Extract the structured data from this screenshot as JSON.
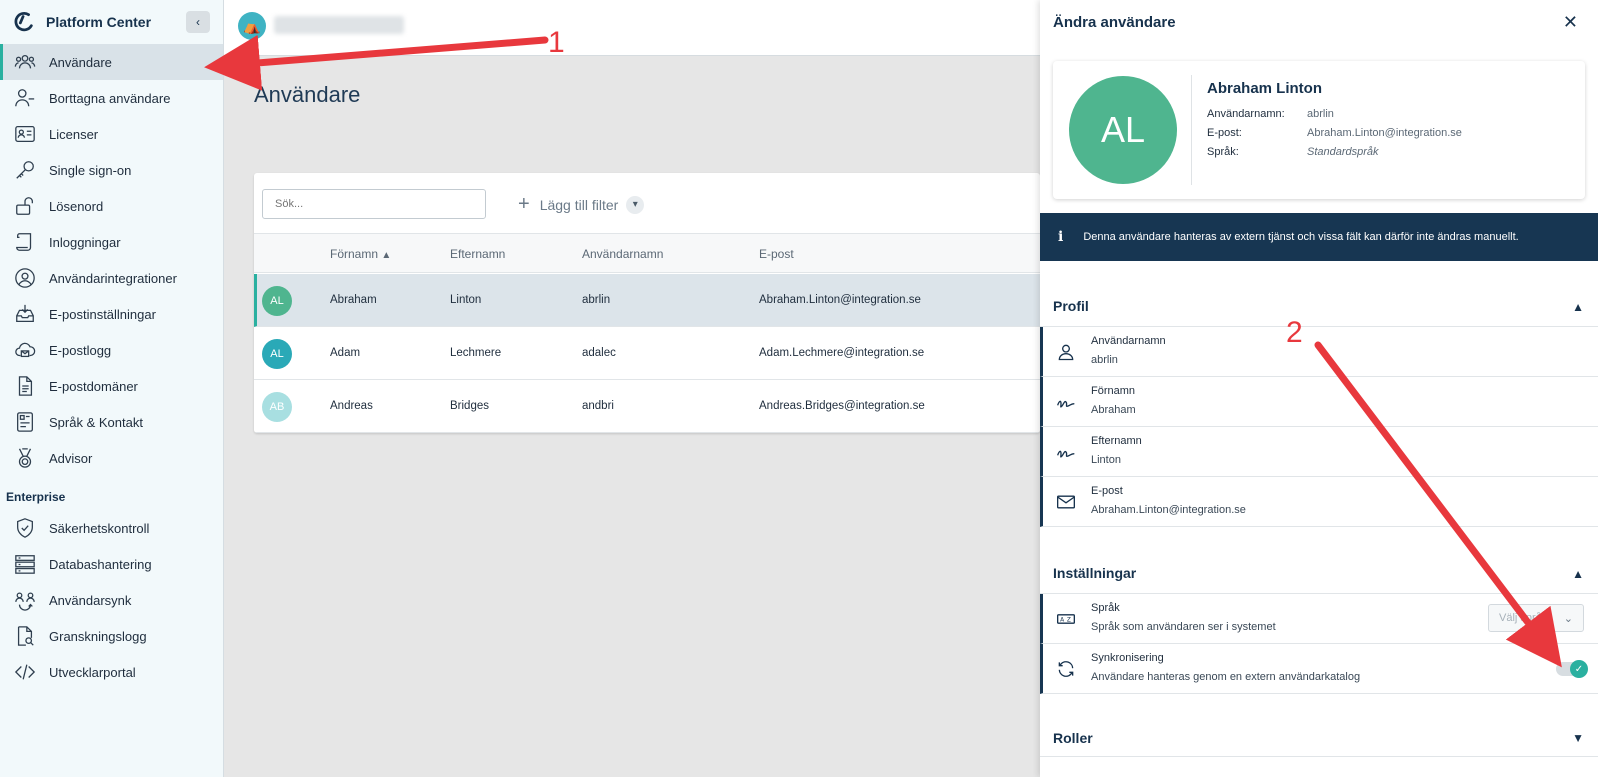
{
  "app": {
    "title": "Platform Center"
  },
  "sidebar": {
    "items": [
      {
        "label": "Användare",
        "icon": "users-icon",
        "active": true
      },
      {
        "label": "Borttagna användare",
        "icon": "user-minus-icon"
      },
      {
        "label": "Licenser",
        "icon": "id-card-icon"
      },
      {
        "label": "Single sign-on",
        "icon": "key-icon"
      },
      {
        "label": "Lösenord",
        "icon": "unlock-icon"
      },
      {
        "label": "Inloggningar",
        "icon": "scroll-icon"
      },
      {
        "label": "Användarintegrationer",
        "icon": "user-circle-icon"
      },
      {
        "label": "E-postinställningar",
        "icon": "inbox-icon"
      },
      {
        "label": "E-postlogg",
        "icon": "cloud-mail-icon"
      },
      {
        "label": "E-postdomäner",
        "icon": "document-icon"
      },
      {
        "label": "Språk & Kontakt",
        "icon": "language-icon"
      },
      {
        "label": "Advisor",
        "icon": "medal-icon"
      }
    ],
    "enterprise_title": "Enterprise",
    "enterprise_items": [
      {
        "label": "Säkerhetskontroll",
        "icon": "shield-check-icon"
      },
      {
        "label": "Databashantering",
        "icon": "server-icon"
      },
      {
        "label": "Användarsynk",
        "icon": "user-sync-icon"
      },
      {
        "label": "Granskningslogg",
        "icon": "file-search-icon"
      },
      {
        "label": "Utvecklarportal",
        "icon": "code-icon"
      }
    ]
  },
  "main": {
    "title": "Användare",
    "search_placeholder": "Sök...",
    "add_filter": "Lägg till filter",
    "columns": [
      "Förnamn",
      "Efternamn",
      "Användarnamn",
      "E-post"
    ],
    "rows": [
      {
        "initials": "AL",
        "first": "Abraham",
        "last": "Linton",
        "username": "abrlin",
        "email": "Abraham.Linton@integration.se",
        "color": "#4fb58f"
      },
      {
        "initials": "AL",
        "first": "Adam",
        "last": "Lechmere",
        "username": "adalec",
        "email": "Adam.Lechmere@integration.se",
        "color": "#2aa9b7"
      },
      {
        "initials": "AB",
        "first": "Andreas",
        "last": "Bridges",
        "username": "andbri",
        "email": "Andreas.Bridges@integration.se",
        "color": "#a8dfe1"
      }
    ]
  },
  "panel": {
    "title": "Ändra användare",
    "user": {
      "initials": "AL",
      "name": "Abraham Linton",
      "username_label": "Användarnamn:",
      "username": "abrlin",
      "email_label": "E-post:",
      "email": "Abraham.Linton@integration.se",
      "language_label": "Språk:",
      "language": "Standardspråk"
    },
    "info": "Denna användare hanteras av extern tjänst och vissa fält kan därför inte ändras manuellt.",
    "profile_title": "Profil",
    "profile_fields": [
      {
        "label": "Användarnamn",
        "value": "abrlin"
      },
      {
        "label": "Förnamn",
        "value": "Abraham"
      },
      {
        "label": "Efternamn",
        "value": "Linton"
      },
      {
        "label": "E-post",
        "value": "Abraham.Linton@integration.se"
      }
    ],
    "settings_title": "Inställningar",
    "settings": {
      "language_title": "Språk",
      "language_desc": "Språk som användaren ser i systemet",
      "language_select": "Välj språk",
      "sync_title": "Synkronisering",
      "sync_desc": "Användare hanteras genom en extern användarkatalog",
      "sync_enabled": true
    },
    "roles_title": "Roller"
  },
  "annotations": {
    "one": "1",
    "two": "2",
    "color": "#e8383d"
  },
  "colors": {
    "accent": "#2ab0a0",
    "navy": "#173652"
  }
}
